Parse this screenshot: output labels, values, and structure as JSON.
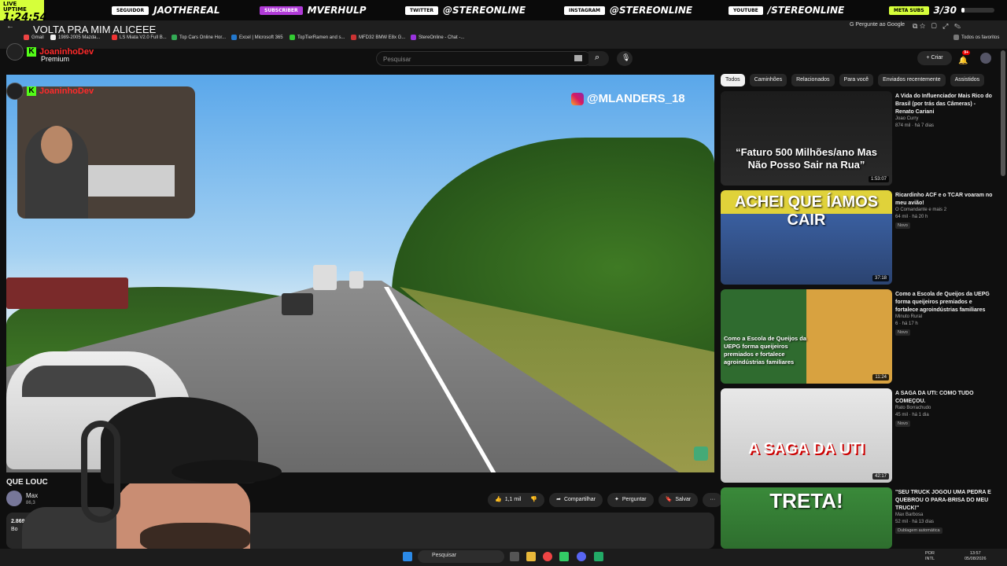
{
  "overlay": {
    "uptime_label": "LIVE UPTIME",
    "uptime_value": "1:24:54",
    "socials": [
      {
        "tag": "SEGUIDOR",
        "handle": "JAOTHEREAL"
      },
      {
        "tag": "SUBSCRIBER",
        "handle": "MVERHULP"
      },
      {
        "tag": "TWITTER",
        "handle": "@STEREONLINE"
      },
      {
        "tag": "INSTAGRAM",
        "handle": "@STEREONLINE"
      },
      {
        "tag": "YOUTUBE",
        "handle": "/STEREONLINE"
      }
    ],
    "meta_label": "META SUBS",
    "meta_value": "3/30",
    "meta_progress": 0.1,
    "now_playing": "VOLTA PRA MIM ALICEEE"
  },
  "browser": {
    "bookmarks": [
      "Gmail",
      "1989-2005 Mazda...",
      "LS Miata V2.0 Full B...",
      "Top Cars Online Hor...",
      "Excel | Microsoft 365",
      "TopTierRamen and s...",
      "MFD32 BMW E8x G...",
      "StereOnline - Chat -..."
    ],
    "ask_google": "Pergunte ao Google",
    "all_favorites": "Todos os favoritos"
  },
  "yt": {
    "premium_label": "Premium",
    "search_placeholder": "Pesquisar",
    "create_label": "Criar",
    "notif_count": "9+"
  },
  "player": {
    "watermark": "@MLANDERS_18",
    "kick_name": "JoaninhoDev"
  },
  "video": {
    "title": "QUE LOUC",
    "channel": "Max",
    "subs": "86,3",
    "likes": "1,1 mil",
    "share": "Compartilhar",
    "ask": "Perguntar",
    "save": "Salvar",
    "desc_line1": "2.869",
    "desc_line2": "Bo"
  },
  "chips": [
    "Todos",
    "Caminhões",
    "Relacionados",
    "Para você",
    "Enviados recentemente",
    "Assistidos"
  ],
  "recommendations": [
    {
      "title": "A Vida do Influenciador Mais Rico do Brasil (por trás das Câmeras) - Renato Cariani",
      "channel": "Joao Curry",
      "meta": "874 mil · há 7 dias",
      "duration": "1:53:07",
      "thumb_text": "“Faturo 500 Milhões/ano Mas Não Posso Sair na Rua”",
      "badge": ""
    },
    {
      "title": "Ricardinho ACF e o TCAR voaram no meu avião!",
      "channel": "O Comandante e mais 2",
      "meta": "64 mil · há 20 h",
      "duration": "37:18",
      "thumb_text": "ACHEI QUE ÍAMOS CAIR",
      "badge": "Novo"
    },
    {
      "title": "Como a Escola de Queijos da UEPG forma queijeiros premiados e fortalece agroindústrias familiares",
      "channel": "Minuto Rural",
      "meta": "6 · há 17 h",
      "duration": "11:24",
      "thumb_text": "Como a Escola de Queijos da UEPG forma queijeiros premiados e fortalece agroindústrias familiares",
      "badge": "Novo"
    },
    {
      "title": "A SAGA DA UTI: COMO TUDO COMEÇOU.",
      "channel": "Rato Borrachudo",
      "meta": "45 mil · há 1 dia",
      "duration": "42:17",
      "thumb_text": "A SAGA DA UTI",
      "badge": "Novo"
    },
    {
      "title": "\"SEU TRUCK JOGOU UMA PEDRA E QUEBROU O PARA-BRISA DO MEU TRUCK!\"",
      "channel": "Max Barbosa",
      "meta": "52 mil · há 13 dias",
      "duration": "",
      "thumb_text": "TRETA!",
      "badge": "Dublagem automática"
    }
  ],
  "taskbar": {
    "search_label": "Pesquisar",
    "lang": "POR",
    "lang2": "INTL",
    "time": "13:57",
    "date": "05/08/2026"
  },
  "colors": {
    "accent_green": "#d6ff3a",
    "kick_green": "#53fc18",
    "yt_bg": "#0f0f0f"
  }
}
